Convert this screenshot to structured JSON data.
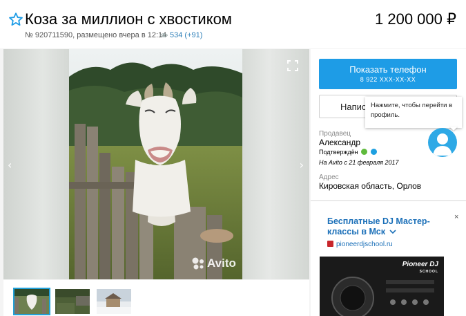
{
  "listing": {
    "title": "Коза за миллион с хвостиком",
    "price": "1 200 000 ₽",
    "meta": "№ 920711590, размещено вчера в 12:14",
    "views": "534 (+91)"
  },
  "gallery": {
    "watermark": "Avito",
    "thumbnails": [
      "goat",
      "garden",
      "house"
    ]
  },
  "contact": {
    "phone_button_label": "Показать телефон",
    "phone_masked": "8 922 XXX-XX-XX",
    "write_button_label": "Напис",
    "tooltip": "Нажмите, чтобы перейти в профиль."
  },
  "seller": {
    "caption": "Продавец",
    "name": "Александр",
    "verified": "Подтверждён",
    "since": "На Avito с 21 февраля 2017"
  },
  "address": {
    "caption": "Адрес",
    "value": "Кировская область, Орлов"
  },
  "ad": {
    "title": "Бесплатные DJ Мастер-классы в Мск",
    "site": "pioneerdjschool.ru",
    "close": "×",
    "logo": "Pioneer DJ",
    "logo_sub": "SCHOOL"
  },
  "colors": {
    "accent": "#1e9ce6",
    "link": "#2d7fb8",
    "avatar": "#2ea9e6",
    "whatsapp_badge": "#5fba3c",
    "verified_badge": "#1ea0e0"
  }
}
